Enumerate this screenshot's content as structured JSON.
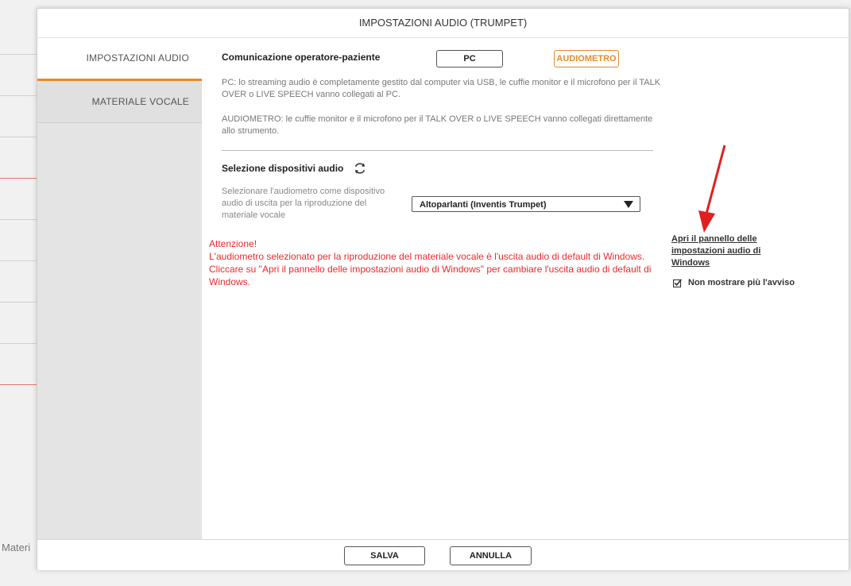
{
  "background": {
    "bottom_text": "Materi"
  },
  "dialog": {
    "title": "IMPOSTAZIONI AUDIO (TRUMPET)"
  },
  "sidebar": {
    "items": [
      {
        "label": "IMPOSTAZIONI AUDIO",
        "active": true
      },
      {
        "label": "MATERIALE VOCALE",
        "active": false
      }
    ]
  },
  "comm": {
    "label": "Comunicazione operatore-paziente",
    "pc_label": "PC",
    "audiometro_label": "AUDIOMETRO",
    "selected": "AUDIOMETRO",
    "pc_desc": "PC: lo streaming audio è completamente gestito dal computer via USB, le cuffie monitor e il microfono per il TALK OVER o LIVE SPEECH vanno collegati al PC.",
    "audiometro_desc": "AUDIOMETRO: le cuffie monitor e il microfono per il TALK OVER o LIVE SPEECH vanno collegati direttamente allo strumento."
  },
  "devices": {
    "title": "Selezione dispositivi audio",
    "refresh_icon": "refresh-icon",
    "desc": "Selezionare l'audiometro come dispositivo audio di uscita per la riproduzione del materiale vocale",
    "selected_device": "Altoparlanti (Inventis Trumpet)"
  },
  "warning": {
    "line1": "Attenzione!",
    "line2": "L'audiometro selezionato per la riproduzione del materiale vocale è l'uscita audio di default di Windows.",
    "line3": "Cliccare su \"Apri il pannello delle impostazioni audio di Windows\" per cambiare l'uscita audio di default di Windows."
  },
  "side_actions": {
    "link": "Apri il pannello delle impostazioni audio di Windows",
    "checkbox_label": "Non mostrare più l'avviso",
    "checkbox_checked": true
  },
  "footer": {
    "save_label": "SALVA",
    "cancel_label": "ANNULLA"
  },
  "colors": {
    "accent_orange": "#e8892c",
    "warning_red": "#ee2a2a",
    "annotation_arrow": "#e02020"
  }
}
